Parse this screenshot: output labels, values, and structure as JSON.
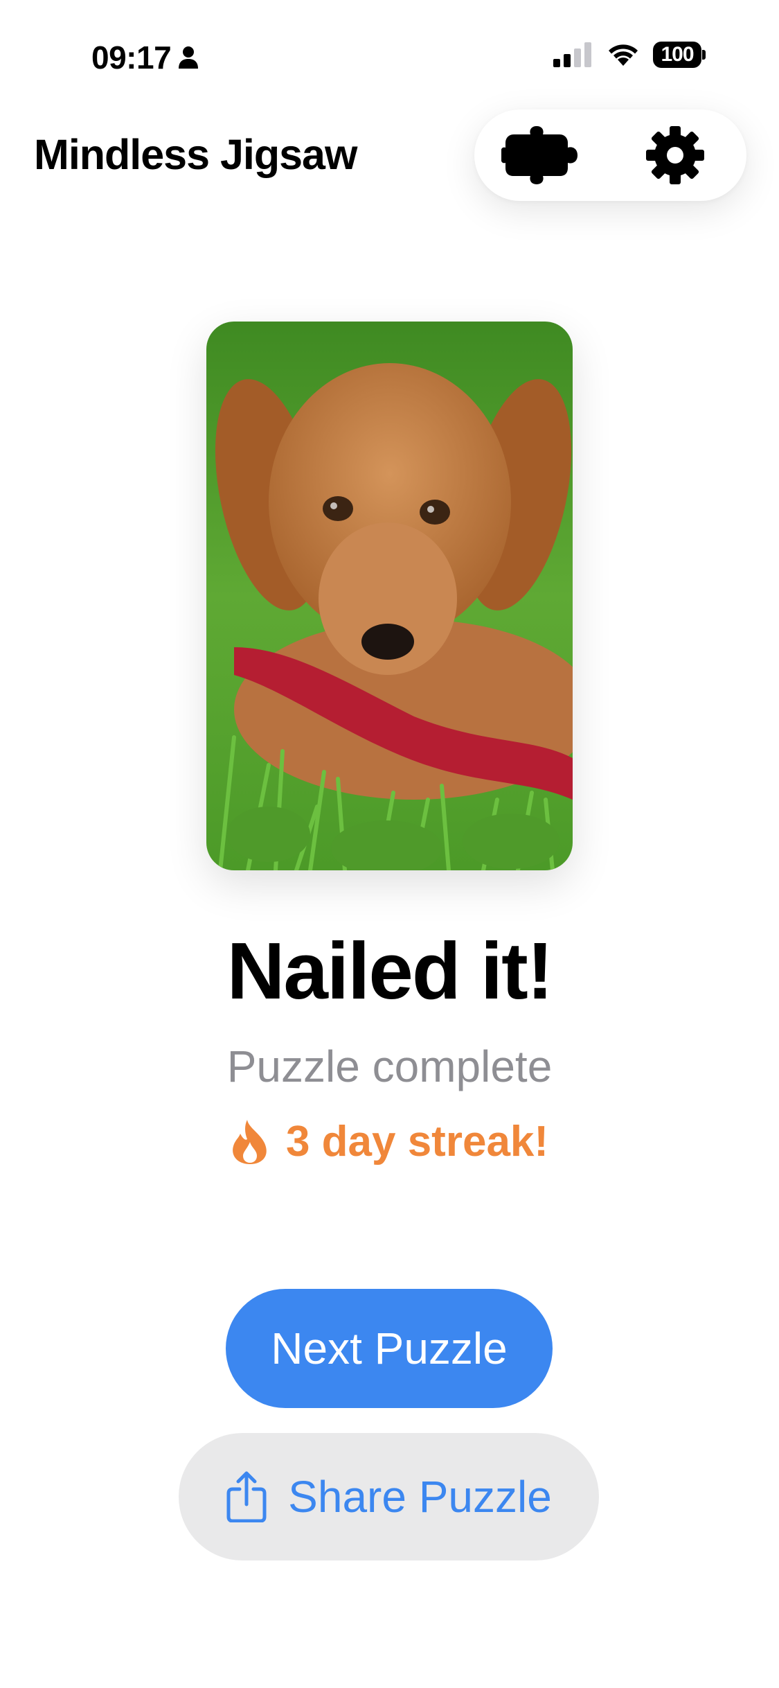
{
  "status_bar": {
    "time": "09:17",
    "battery": "100",
    "icons": [
      "person-icon",
      "signal-icon",
      "wifi-icon",
      "battery-icon"
    ]
  },
  "header": {
    "title": "Mindless Jigsaw",
    "actions": [
      "puzzle-piece-icon",
      "gear-icon"
    ]
  },
  "photo": {
    "subject": "golden retriever puppy lying in grass with a red leash"
  },
  "result": {
    "headline": "Nailed it!",
    "subtitle": "Puzzle complete",
    "streak": "3 day streak!"
  },
  "actions": {
    "next_label": "Next Puzzle",
    "share_label": "Share Puzzle"
  },
  "colors": {
    "accent": "#3c87f0",
    "streak": "#f0873a",
    "subtitle": "#8e8e93",
    "share_bg": "#e9e9ea"
  }
}
